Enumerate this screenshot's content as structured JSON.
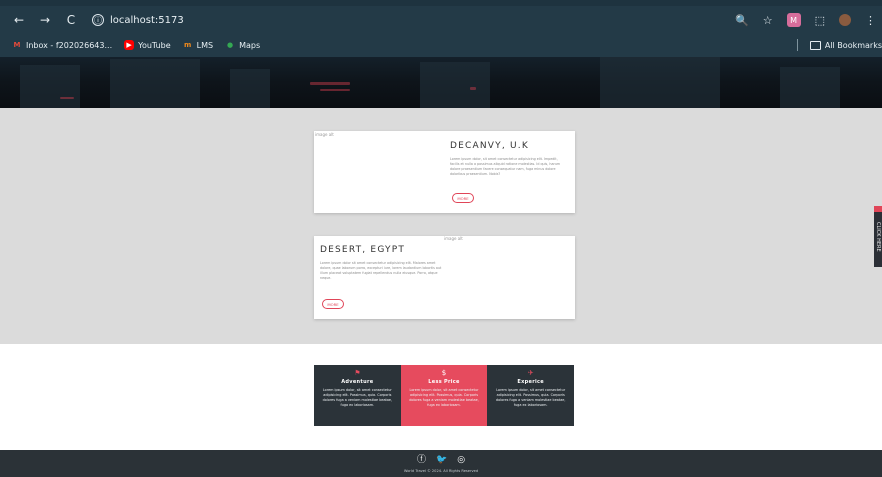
{
  "browser": {
    "url": "localhost:5173",
    "nav_back": "←",
    "nav_forward": "→",
    "nav_reload": "C",
    "info_icon": "ⓘ",
    "zoom_icon": "🔍",
    "star_icon": "☆",
    "profile_badge": "M",
    "extensions_icon": "⬚",
    "menu_icon": "⋮"
  },
  "bookmarks": {
    "items": [
      {
        "label": "Inbox - f202026643...",
        "icon": "gmail-icon",
        "color": "#e24a3b"
      },
      {
        "label": "YouTube",
        "icon": "youtube-icon",
        "color": "#ff0000"
      },
      {
        "label": "LMS",
        "icon": "lms-icon",
        "color": "#f08a1c"
      },
      {
        "label": "Maps",
        "icon": "maps-icon",
        "color": "#34a853"
      }
    ],
    "all_bookmarks": "All Bookmarks"
  },
  "cards": [
    {
      "title": "DECANVY, U.K",
      "image_alt": "image alt",
      "text": "Lorem ipsum dolor, sit amet consectetur adipisicing elit. Impedit, facilis et nulla a possimus aliquid ratione molestias. Id quis, harum dolore praesentium facere consequatur nam, fuga minus dolore doloribus praesentium. Nobis?",
      "button": "MORE"
    },
    {
      "title": "DESERT, EGYPT",
      "image_alt": "image alt",
      "text": "Lorem ipsum dolor sit amet consectetur adipisicing elit. Maiores amet dolore, quae laborum porro, excepturi iure, lorem laudantium lobortis aut illum placeat voluptatem fugiat repellendus nulla eiusque. Porro, atque neque.",
      "button": "MORE"
    }
  ],
  "side_tab": "CLICK HERE",
  "features": [
    {
      "title": "Adventure",
      "icon": "flag-icon",
      "text": "Lorem ipsum dolor, sit amet consectetur adipisicing elit. Possimus, quia. Corporis dolores fuga a veniam molestiae beatae, fuga ex laboriosam."
    },
    {
      "title": "Less Price",
      "icon": "dollar-icon",
      "text": "Lorem ipsum dolor, sit amet consectetur adipisicing elit. Possimus, quia. Corporis dolores fuga a veniam molestiae beatae, fuga ex laboriosam."
    },
    {
      "title": "Experice",
      "icon": "plane-icon",
      "text": "Lorem ipsum dolor, sit amet consectetur adipisicing elit. Possimus, quia. Corporis dolores fuga a veniam molestiae beatae, fuga ex laboriosam."
    }
  ],
  "footer": {
    "socials": [
      "facebook-icon",
      "twitter-icon",
      "instagram-icon"
    ],
    "copyright": "World Travel © 2024. All Rights Reserved"
  }
}
